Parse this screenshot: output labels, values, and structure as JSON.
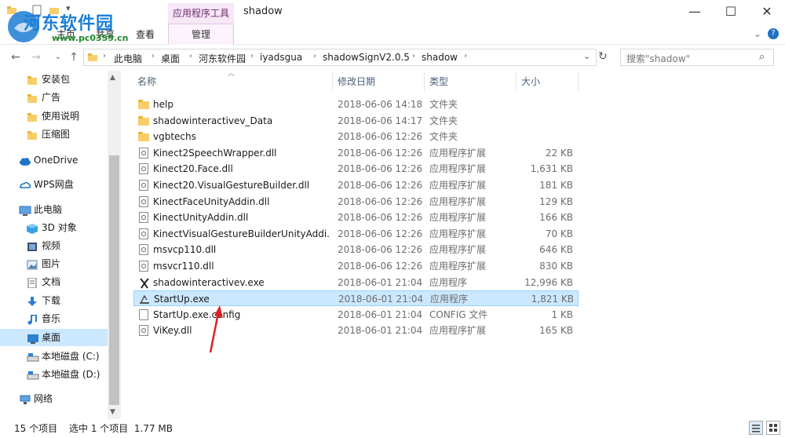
{
  "window": {
    "title": "shadow",
    "context_group": "应用程序工具",
    "context_tab": "管理",
    "tabs": [
      "主页",
      "共享",
      "查看"
    ],
    "minimize": "—",
    "maximize": "☐",
    "close": "✕"
  },
  "watermark": {
    "name": "河东软件园",
    "url": "www.pc0359.cn"
  },
  "address": {
    "crumbs": [
      "此电脑",
      "桌面",
      "河东软件园",
      "iyadsgua",
      "shadowSignV2.0.5",
      "shadow"
    ],
    "search_placeholder": "搜索\"shadow\""
  },
  "nav": [
    {
      "label": "安装包",
      "icon": "folder-icon",
      "indent": 1
    },
    {
      "label": "广告",
      "icon": "folder-icon",
      "indent": 1
    },
    {
      "label": "使用说明",
      "icon": "folder-icon",
      "indent": 1
    },
    {
      "label": "压缩图",
      "icon": "folder-icon",
      "indent": 1
    },
    {
      "label": "OneDrive",
      "icon": "cloud-icon",
      "indent": 0
    },
    {
      "label": "WPS网盘",
      "icon": "wps-cloud-icon",
      "indent": 0
    },
    {
      "label": "此电脑",
      "icon": "computer-icon",
      "indent": 0
    },
    {
      "label": "3D 对象",
      "icon": "cube-icon",
      "indent": 1
    },
    {
      "label": "视频",
      "icon": "video-icon",
      "indent": 1
    },
    {
      "label": "图片",
      "icon": "picture-icon",
      "indent": 1
    },
    {
      "label": "文档",
      "icon": "document-icon",
      "indent": 1
    },
    {
      "label": "下载",
      "icon": "download-icon",
      "indent": 1
    },
    {
      "label": "音乐",
      "icon": "music-icon",
      "indent": 1
    },
    {
      "label": "桌面",
      "icon": "desktop-icon",
      "indent": 1,
      "selected": true
    },
    {
      "label": "本地磁盘 (C:)",
      "icon": "drive-icon",
      "indent": 1
    },
    {
      "label": "本地磁盘 (D:)",
      "icon": "drive-icon",
      "indent": 1
    },
    {
      "label": "网络",
      "icon": "network-icon",
      "indent": 0
    }
  ],
  "columns": {
    "name": "名称",
    "date": "修改日期",
    "type": "类型",
    "size": "大小"
  },
  "files": [
    {
      "name": "help",
      "date": "2018-06-06 14:18",
      "type": "文件夹",
      "size": "",
      "icon": "folder-icon"
    },
    {
      "name": "shadowinteractivev_Data",
      "date": "2018-06-06 14:17",
      "type": "文件夹",
      "size": "",
      "icon": "folder-icon"
    },
    {
      "name": "vgbtechs",
      "date": "2018-06-06 12:26",
      "type": "文件夹",
      "size": "",
      "icon": "folder-icon"
    },
    {
      "name": "Kinect2SpeechWrapper.dll",
      "date": "2018-06-06 12:26",
      "type": "应用程序扩展",
      "size": "22 KB",
      "icon": "dll-icon"
    },
    {
      "name": "Kinect20.Face.dll",
      "date": "2018-06-06 12:26",
      "type": "应用程序扩展",
      "size": "1,631 KB",
      "icon": "dll-icon"
    },
    {
      "name": "Kinect20.VisualGestureBuilder.dll",
      "date": "2018-06-06 12:26",
      "type": "应用程序扩展",
      "size": "181 KB",
      "icon": "dll-icon"
    },
    {
      "name": "KinectFaceUnityAddin.dll",
      "date": "2018-06-06 12:26",
      "type": "应用程序扩展",
      "size": "129 KB",
      "icon": "dll-icon"
    },
    {
      "name": "KinectUnityAddin.dll",
      "date": "2018-06-06 12:26",
      "type": "应用程序扩展",
      "size": "166 KB",
      "icon": "dll-icon"
    },
    {
      "name": "KinectVisualGestureBuilderUnityAddi...",
      "date": "2018-06-06 12:26",
      "type": "应用程序扩展",
      "size": "70 KB",
      "icon": "dll-icon"
    },
    {
      "name": "msvcp110.dll",
      "date": "2018-06-06 12:26",
      "type": "应用程序扩展",
      "size": "646 KB",
      "icon": "dll-icon"
    },
    {
      "name": "msvcr110.dll",
      "date": "2018-06-06 12:26",
      "type": "应用程序扩展",
      "size": "830 KB",
      "icon": "dll-icon"
    },
    {
      "name": "shadowinteractivev.exe",
      "date": "2018-06-01 21:04",
      "type": "应用程序",
      "size": "12,996 KB",
      "icon": "figure-exe-icon"
    },
    {
      "name": "StartUp.exe",
      "date": "2018-06-01 21:04",
      "type": "应用程序",
      "size": "1,821 KB",
      "icon": "startup-exe-icon",
      "selected": true
    },
    {
      "name": "StartUp.exe.config",
      "date": "2018-06-01 21:04",
      "type": "CONFIG 文件",
      "size": "1 KB",
      "icon": "config-file-icon"
    },
    {
      "name": "ViKey.dll",
      "date": "2018-06-01 21:04",
      "type": "应用程序扩展",
      "size": "165 KB",
      "icon": "dll-icon"
    }
  ],
  "status": {
    "count": "15 个项目",
    "selected": "选中 1 个项目  1.77 MB"
  },
  "colors": {
    "selection": "#cce8ff",
    "selection_border": "#99d1ff",
    "context_tab": "#f7e7f7",
    "annotation_arrow": "#e02020"
  }
}
